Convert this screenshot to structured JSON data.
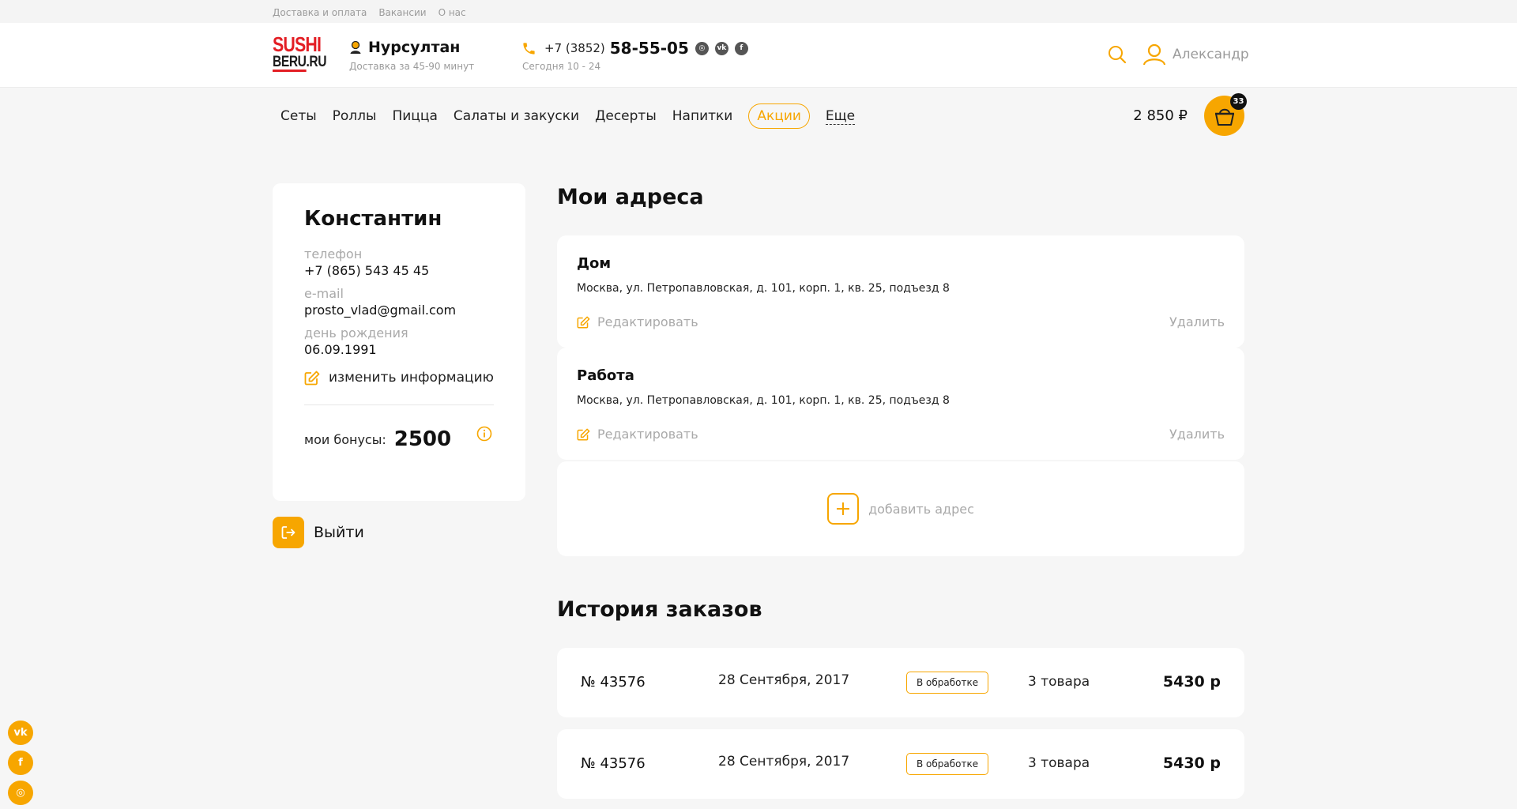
{
  "topbar": {
    "links": [
      "Доставка и оплата",
      "Вакансии",
      "О нас"
    ]
  },
  "header": {
    "logo": {
      "line1": "SUSHI",
      "line2": "BERU.RU"
    },
    "city": {
      "name": "Нурсултан",
      "delivery": "Доставка за 45-90 минут"
    },
    "phone": {
      "code": "+7 (3852)",
      "number": "58-55-05",
      "hours": "Сегодня 10 - 24"
    },
    "user": {
      "name": "Александр"
    }
  },
  "nav": {
    "items": [
      "Сеты",
      "Роллы",
      "Пицца",
      "Салаты и закуски",
      "Десерты",
      "Напитки"
    ],
    "promo": "Акции",
    "more": "Еще",
    "total": "2 850 ₽",
    "cart_count": "33"
  },
  "profile": {
    "name": "Константин",
    "phone_label": "телефон",
    "phone": "+7 (865) 543 45 45",
    "email_label": "e-mail",
    "email": "prosto_vlad@gmail.com",
    "birthday_label": "день рождения",
    "birthday": "06.09.1991",
    "edit_label": "изменить информацию",
    "bonus_label": "мои бонусы:",
    "bonus_value": "2500",
    "logout": "Выйти"
  },
  "addresses": {
    "title": "Мои адреса",
    "items": [
      {
        "name": "Дом",
        "address": "Москва, ул. Петропавловская, д. 101, корп. 1, кв. 25, подъезд 8",
        "edit": "Редактировать",
        "delete": "Удалить"
      },
      {
        "name": "Работа",
        "address": "Москва, ул. Петропавловская, д. 101, корп. 1, кв. 25, подъезд 8",
        "edit": "Редактировать",
        "delete": "Удалить"
      }
    ],
    "add_label": "добавить адрес"
  },
  "orders": {
    "title": "История заказов",
    "items": [
      {
        "number": "№ 43576",
        "date": "28 Сентября, 2017",
        "status": "В обработке",
        "qty": "3 товара",
        "price": "5430 р"
      },
      {
        "number": "№ 43576",
        "date": "28 Сентября, 2017",
        "status": "В обработке",
        "qty": "3 товара",
        "price": "5430 р"
      }
    ]
  },
  "colors": {
    "accent": "#f7a600",
    "brand_red": "#e31e24",
    "muted": "#9b9b9b"
  }
}
